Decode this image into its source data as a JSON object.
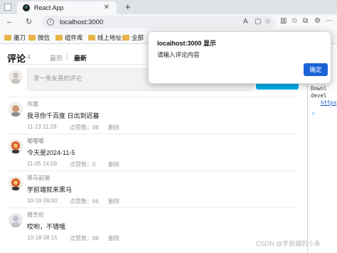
{
  "browser": {
    "tab_title": "React App",
    "tab_close": "✕",
    "new_tab": "+",
    "back": "←",
    "reload": "↻",
    "address": "localhost:3000",
    "bookmarks": [
      "墨刀",
      "微信",
      "组件库",
      "线上地址",
      "全部"
    ]
  },
  "app": {
    "title": "评论",
    "count": "4",
    "tab_hot": "最热",
    "tab_new": "最新",
    "input_placeholder": "发一条友善的评论",
    "comments": [
      {
        "user": "许嵩",
        "text": "我寻你千百度 日出到迟暮",
        "time": "11-13 11:29",
        "likes": "点赞数：88",
        "delete": "删除"
      },
      {
        "user": "嘟嘟嘟",
        "text": "今天是2024-11-5",
        "time": "11-05 14:59",
        "likes": "点赞数：0",
        "delete": "删除"
      },
      {
        "user": "黑马前端",
        "text": "学前端就来黑马",
        "time": "10-19 09:00",
        "likes": "点赞数：66",
        "delete": "删除"
      },
      {
        "user": "周杰伦",
        "text": "哎哟，不错哦",
        "time": "10-18 08:15",
        "likes": "点赞数：88",
        "delete": "删除"
      }
    ]
  },
  "dialog": {
    "title": "localhost:3000 显示",
    "message": "请输入评论内容",
    "ok_label": "确定"
  },
  "devtools": {
    "line1": "Downl",
    "line2": "devel",
    "link": "https"
  },
  "watermark": "CSDN @学前端的小朱",
  "colors": {
    "accent_blue": "#00aeec",
    "dialog_button": "#1a62d6",
    "active_tab": "#222222",
    "inactive_tab": "#999999"
  }
}
